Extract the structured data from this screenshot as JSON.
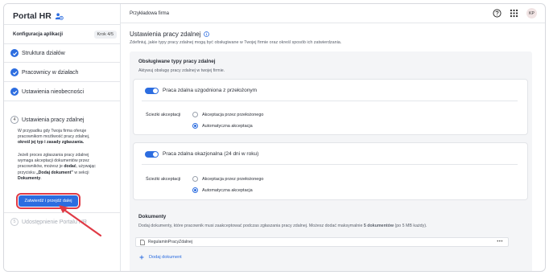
{
  "app": {
    "title": "Portal HR"
  },
  "sidebar": {
    "config_title": "Konfiguracja aplikacji",
    "step_badge": "Krok 4/5",
    "steps": [
      {
        "label": "Struktura działów",
        "status": "done"
      },
      {
        "label": "Pracownicy w działach",
        "status": "done"
      },
      {
        "label": "Ustawienia nieobecności",
        "status": "done"
      }
    ],
    "active_step": {
      "number": "4",
      "label": "Ustawienia pracy zdalnej",
      "p1_a": "W przypadku gdy Twoja firma oferuje",
      "p1_b": "pracownikom możliwość pracy zdalnej,",
      "p1_c": "określ jej typ i zasady zgłaszania.",
      "p2_a": "Jeżeli proces zgłaszania pracy zdalnej",
      "p2_b": "wymaga akceptacji dokumentów przez",
      "p2_c1": "pracowników, możesz je ",
      "p2_c2": "dodać",
      "p2_c3": ", używając",
      "p2_d1": "przycisku ",
      "p2_d2": "„Dodaj dokument”",
      "p2_d3": " w sekcji",
      "p2_e": "Dokumenty",
      "p2_e2": ".",
      "button": "Zatwierdź i przejdź dalej"
    },
    "disabled_step": {
      "number": "5",
      "label": "Udostępnienie Portalu HR"
    }
  },
  "topbar": {
    "company": "Przykładowa firma",
    "avatar": "KP",
    "icons": [
      "help-icon",
      "apps-grid-icon"
    ]
  },
  "main": {
    "title": "Ustawienia pracy zdalnej",
    "subtitle": "Zdefiniuj, jakie typy pracy zdalnej mogą być obsługiwane w Twojej firmie oraz określ sposób ich zatwierdzania.",
    "types_section": {
      "title": "Obsługiwane typy pracy zdalnej",
      "subtitle": "Aktywuj obsługę pracy zdalnej w twojej firmie."
    },
    "cards": [
      {
        "toggle_label": "Praca zdalna uzgodniona z przełożonym",
        "enabled": true,
        "paths_label": "Ścieżki akceptacji",
        "options": [
          "Akceptacja przez przełożonego",
          "Automatyczna akceptacja"
        ],
        "selected": 1
      },
      {
        "toggle_label": "Praca zdalna okazjonalna (24 dni w roku)",
        "enabled": true,
        "paths_label": "Ścieżki akceptacji",
        "options": [
          "Akceptacja przez przełożonego",
          "Automatyczna akceptacja"
        ],
        "selected": 1
      }
    ],
    "documents": {
      "title": "Dokumenty",
      "subtitle_a": "Dodaj dokumenty, które pracownik musi zaakceptować podczas zgłaszania pracy zdalnej. Możesz dodać maksymalnie ",
      "subtitle_b": "5 dokumentów",
      "subtitle_c": " (po 5 MB każdy).",
      "file": "RegulaminPracyZdalnej",
      "more": "•••",
      "add_label": "Dodaj dokument"
    }
  },
  "colors": {
    "accent": "#2c6de0",
    "highlight": "#e03a45"
  }
}
